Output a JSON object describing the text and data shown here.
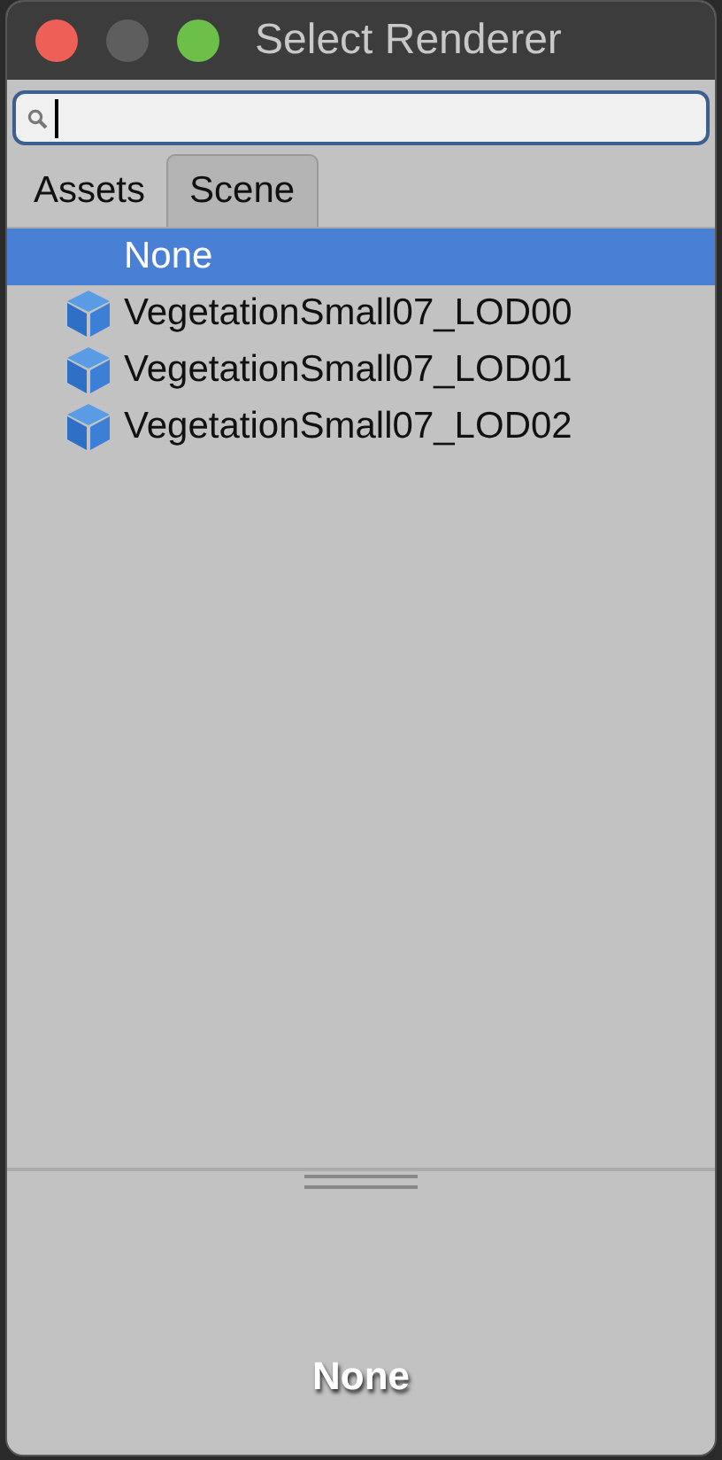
{
  "window": {
    "title": "Select Renderer"
  },
  "tabs": [
    {
      "label": "Assets",
      "selected": false
    },
    {
      "label": "Scene",
      "selected": true
    }
  ],
  "items": [
    {
      "label": "None",
      "kind": "none",
      "selected": true
    },
    {
      "label": "VegetationSmall07_LOD00",
      "kind": "object",
      "selected": false
    },
    {
      "label": "VegetationSmall07_LOD01",
      "kind": "object",
      "selected": false
    },
    {
      "label": "VegetationSmall07_LOD02",
      "kind": "object",
      "selected": false
    }
  ],
  "preview": {
    "label": "None"
  }
}
